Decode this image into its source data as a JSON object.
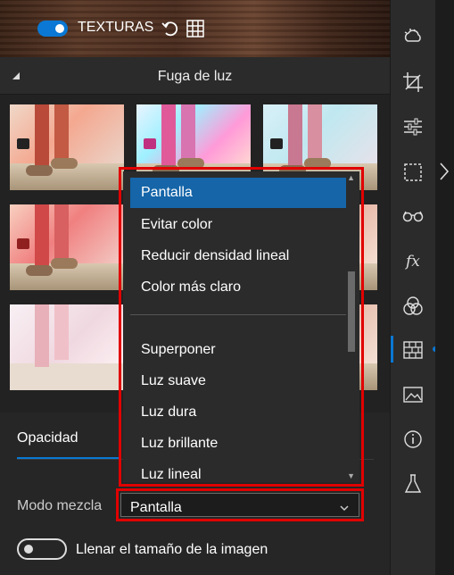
{
  "header": {
    "textures_label": "TEXTURAS",
    "textures_toggle": "on",
    "undo_icon": "undo-icon",
    "grid_icon": "grid-icon"
  },
  "section": {
    "title": "Fuga de luz",
    "collapse_icon": "collapse-triangle-icon"
  },
  "thumbnails": [
    {
      "id": "thumb-1"
    },
    {
      "id": "thumb-2"
    },
    {
      "id": "thumb-3"
    },
    {
      "id": "thumb-4"
    },
    {
      "id": "thumb-5"
    },
    {
      "id": "thumb-6"
    },
    {
      "id": "thumb-7"
    },
    {
      "id": "thumb-8"
    },
    {
      "id": "thumb-9"
    }
  ],
  "dropdown": {
    "options": [
      {
        "label": "Pantalla",
        "selected": true
      },
      {
        "label": "Evitar color",
        "selected": false
      },
      {
        "label": "Reducir densidad lineal",
        "selected": false
      },
      {
        "label": "Color más claro",
        "selected": false
      },
      {
        "label": "Superponer",
        "selected": false
      },
      {
        "label": "Luz suave",
        "selected": false
      },
      {
        "label": "Luz dura",
        "selected": false
      },
      {
        "label": "Luz brillante",
        "selected": false
      },
      {
        "label": "Luz lineal",
        "selected": false
      }
    ]
  },
  "bottom": {
    "opacity_tab": "Opacidad",
    "blend_mode_label": "Modo mezcla",
    "blend_mode_value": "Pantalla",
    "fill_label": "Llenar el tamaño de la imagen",
    "fill_toggle": "off"
  },
  "toolbar": {
    "tools": [
      {
        "name": "weather-icon"
      },
      {
        "name": "crop-icon"
      },
      {
        "name": "adjust-sliders-icon"
      },
      {
        "name": "selection-icon"
      },
      {
        "name": "glasses-icon"
      },
      {
        "name": "fx-icon"
      },
      {
        "name": "overlay-circles-icon"
      },
      {
        "name": "textures-brick-icon"
      },
      {
        "name": "image-icon"
      },
      {
        "name": "info-icon"
      },
      {
        "name": "flask-icon"
      }
    ],
    "fx_text": "fx",
    "active_tool": "textures-brick-icon"
  },
  "colors": {
    "accent": "#0a78d4",
    "highlight_border": "#e10000",
    "selected_option": "#1565a8"
  }
}
